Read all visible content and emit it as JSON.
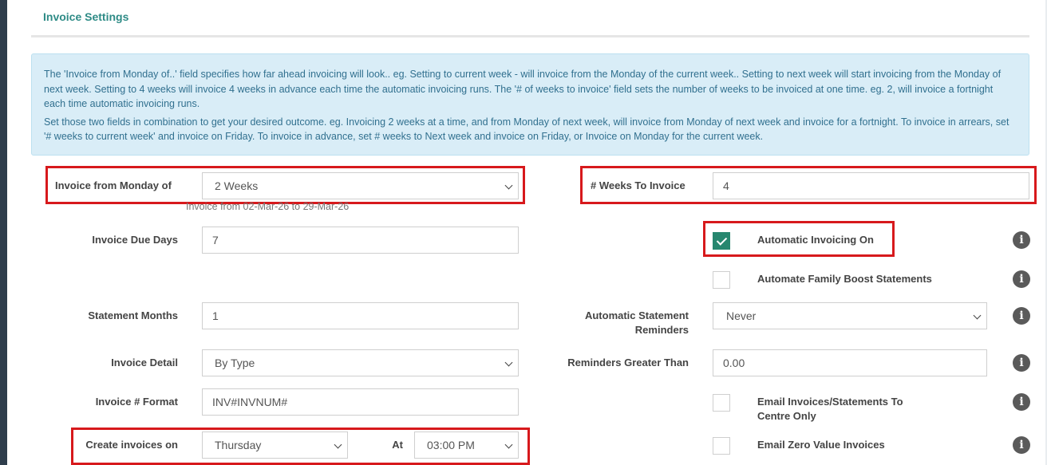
{
  "section": {
    "title": "Invoice Settings"
  },
  "info": {
    "paragraph1": "The 'Invoice from Monday of..' field specifies how far ahead invoicing will look.. eg. Setting to current week - will invoice from the Monday of the current week.. Setting to next week will start invoicing from the Monday of next week. Setting to 4 weeks will invoice 4 weeks in advance each time the automatic invoicing runs. The '# of weeks to invoice' field sets the number of weeks to be invoiced at one time. eg. 2, will invoice a fortnight each time automatic invoicing runs.",
    "paragraph2": "Set those two fields in combination to get your desired outcome. eg. Invoicing 2 weeks at a time, and from Monday of next week, will invoice from Monday of next week and invoice for a fortnight. To invoice in arrears, set '# weeks to current week' and invoice on Friday. To invoice in advance, set # weeks to Next week and invoice on Friday, or Invoice on Monday for the current week."
  },
  "form": {
    "invoice_from": {
      "label": "Invoice from Monday of",
      "value": "2 Weeks",
      "hint": "Invoice from 02-Mar-26 to 29-Mar-26"
    },
    "weeks_to_invoice": {
      "label": "# Weeks To Invoice",
      "value": "4"
    },
    "due_days": {
      "label": "Invoice Due Days",
      "value": "7"
    },
    "auto_invoicing": {
      "label": "Automatic Invoicing On",
      "checked": true
    },
    "family_boost": {
      "label": "Automate Family Boost Statements",
      "checked": false
    },
    "statement_months": {
      "label": "Statement Months",
      "value": "1"
    },
    "statement_reminders": {
      "label": "Automatic Statement Reminders",
      "value": "Never"
    },
    "invoice_detail": {
      "label": "Invoice Detail",
      "value": "By Type"
    },
    "reminders_greater": {
      "label": "Reminders Greater Than",
      "value": "0.00"
    },
    "invoice_format": {
      "label": "Invoice # Format",
      "value": "INV#INVNUM#"
    },
    "email_centre_only": {
      "label": "Email Invoices/Statements To Centre Only",
      "checked": false
    },
    "create_on": {
      "label": "Create invoices on",
      "value": "Thursday"
    },
    "at": {
      "label": "At",
      "value": "03:00 PM"
    },
    "email_zero": {
      "label": "Email Zero Value Invoices",
      "checked": false
    }
  },
  "icons": {
    "info": "info-circle-icon",
    "check": "check-icon",
    "dropdown": "chevron-down-icon"
  },
  "colors": {
    "accent": "#2e8b86",
    "highlight": "#d7191c",
    "checked": "#27876f",
    "info_bg": "#d9edf7"
  }
}
